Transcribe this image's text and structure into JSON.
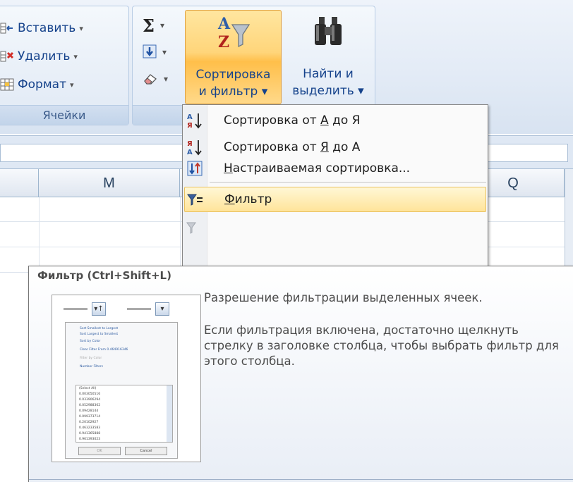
{
  "ribbon": {
    "cells_group": {
      "insert_label": "Вставить",
      "delete_label": "Удалить",
      "format_label": "Формат",
      "dropdown_glyph": "▾",
      "group_label": "Ячейки"
    },
    "editing": {
      "autosum_glyph": "Σ",
      "dropdown_glyph": "▾",
      "sort_filter_line1": "Сортировка",
      "sort_filter_line2": "и фильтр ▾",
      "find_select_line1": "Найти и",
      "find_select_line2": "выделить ▾"
    }
  },
  "columns": {
    "m": "M",
    "q": "Q"
  },
  "menu": {
    "items": [
      {
        "label_pre": "Сортировка от ",
        "label_ul": "А",
        "label_post": " до Я",
        "icon": "sort-a-to-z-icon"
      },
      {
        "label_pre": "Сортировка от ",
        "label_ul": "Я",
        "label_post": " до А",
        "icon": "sort-z-to-a-icon"
      },
      {
        "label_pre": "",
        "label_ul": "Н",
        "label_post": "астраиваемая сортировка...",
        "icon": "custom-sort-icon"
      },
      {
        "label_pre": "",
        "label_ul": "Ф",
        "label_post": "ильтр",
        "icon": "filter-icon"
      },
      {
        "label_pre": "",
        "label_ul": "",
        "label_post": "",
        "icon": "clear-filter-icon"
      }
    ],
    "az_top": "А",
    "az_bottom": "Я"
  },
  "tooltip": {
    "title": "Фильтр (Ctrl+Shift+L)",
    "paragraph1": "Разрешение фильтрации выделенных ячеек.",
    "paragraph2": "Если фильтрация включена, достаточно щелкнуть стрелку в заголовке столбца, чтобы выбрать фильтр для этого столбца.",
    "thumbnail": {
      "menu_lines": [
        "Sort Smallest to Largest",
        "Sort Largest to Smallest",
        "Sort by Color",
        "Clear Filter From 0.464916346",
        "Filter by Color",
        "Number Filters"
      ],
      "check_items": [
        "(Select All)",
        "0.003050516",
        "0.033906294",
        "0.052988362",
        "0.09428144",
        "0.099373714",
        "0.20102927",
        "0.463233583",
        "0.941365888",
        "0.961393023"
      ],
      "ok_label": "OK",
      "cancel_label": "Cancel"
    }
  },
  "colors": {
    "ribbon_text": "#15428b",
    "highlight": "#ffd57a",
    "menu_hot": "#ffe49a"
  }
}
